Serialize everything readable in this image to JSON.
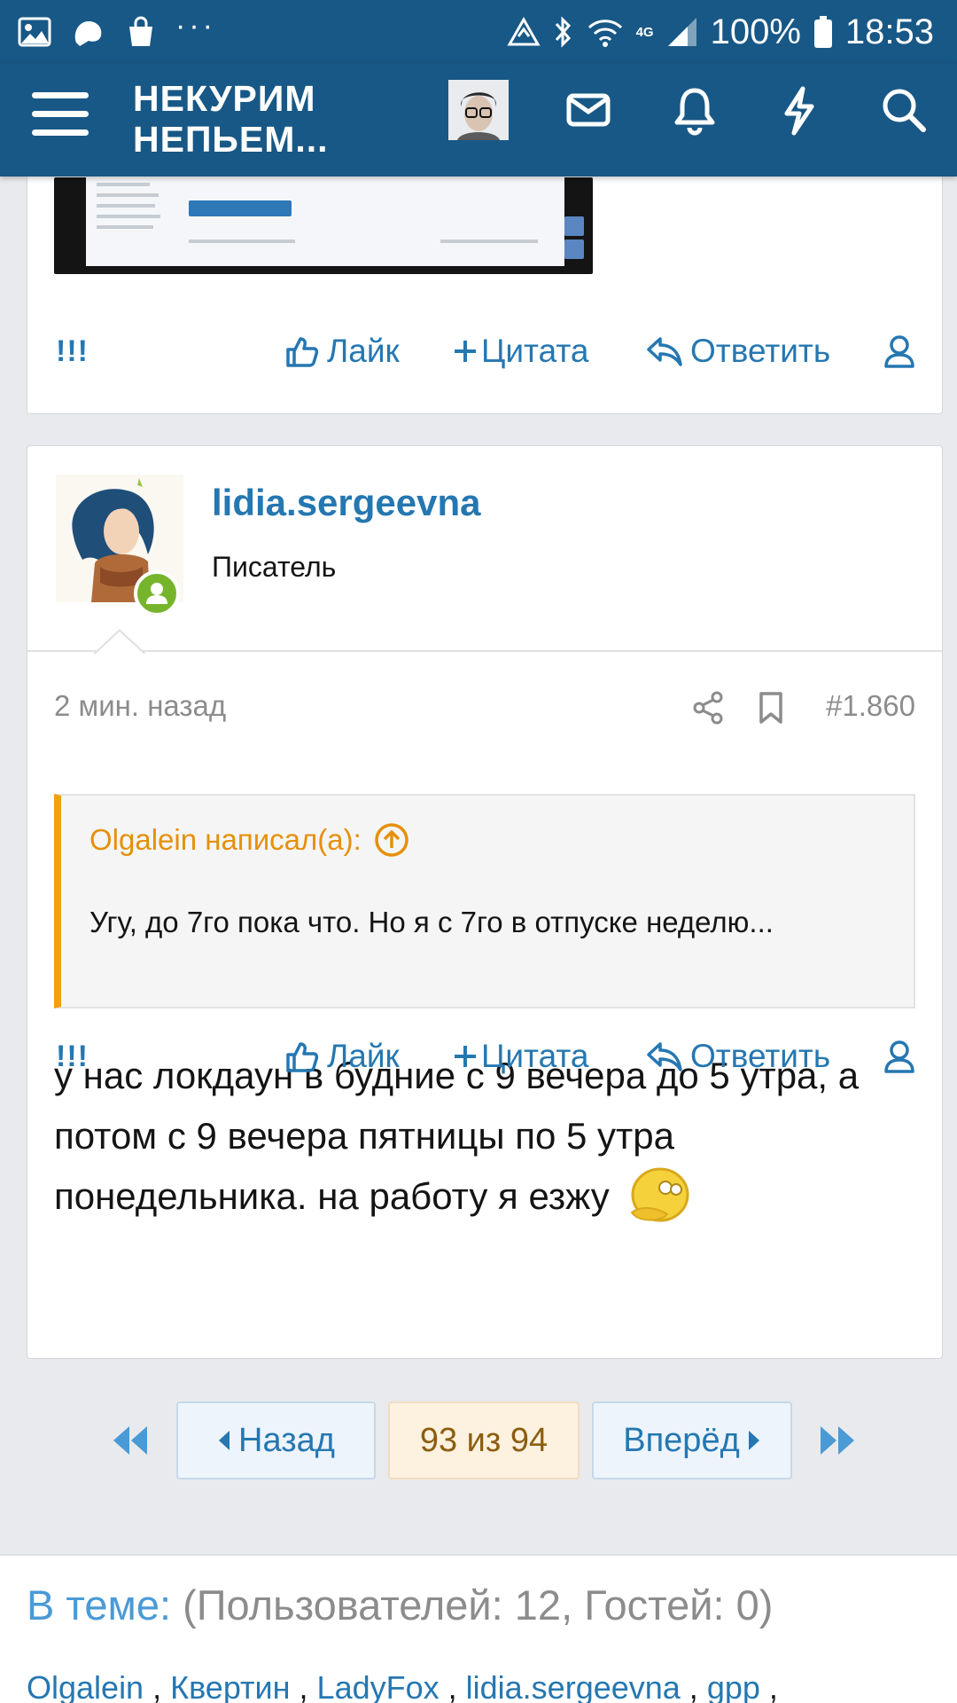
{
  "status_bar": {
    "battery": "100%",
    "time": "18:53",
    "network": "4G",
    "dots": "···"
  },
  "header": {
    "logo_line1": "НЕКУРИМ",
    "logo_line2": "НЕПЬЕМ..."
  },
  "top_post": {
    "marker": "!!!",
    "like_label": "Лайк",
    "quote_label": "Цитата",
    "reply_label": "Ответить"
  },
  "post": {
    "author": "lidia.sergeevna",
    "user_title": "Писатель",
    "time": "2 мин. назад",
    "number": "#1.860",
    "quote": {
      "author": "Olgalein написал(а):",
      "text": "Угу, до 7го пока что. Но я с 7го в отпуске неделю..."
    },
    "text": "у нас локдаун в будние с 9 вечера до 5 утра, а потом с 9 вечера пятницы по 5 утра понедельника. на работу я езжу",
    "marker": "!!!",
    "like_label": "Лайк",
    "quote_label": "Цитата",
    "reply_label": "Ответить"
  },
  "pagination": {
    "prev_label": "Назад",
    "current": "93 из 94",
    "next_label": "Вперёд"
  },
  "footer": {
    "in_thread_label": "В теме:",
    "counts": "(Пользователей: 12, Гостей: 0)",
    "users": [
      "Olgalein",
      "Квертин",
      "LadyFox",
      "lidia.sergeevna",
      "gpp"
    ]
  },
  "colors": {
    "header_bg": "#185886",
    "link": "#2577b1",
    "quote_accent": "#f0a10e",
    "online": "#76b52b"
  }
}
